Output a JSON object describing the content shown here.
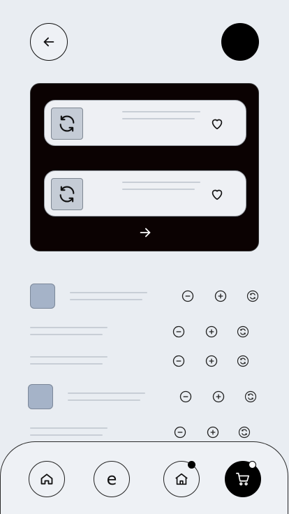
{
  "header": {
    "back_icon": "arrow-left-icon",
    "avatar_color": "#000000"
  },
  "featured": {
    "items": [
      {
        "icon": "refresh-icon",
        "favorite_icon": "heart-icon"
      },
      {
        "icon": "refresh-icon",
        "favorite_icon": "heart-icon"
      }
    ],
    "next_icon": "arrow-right-icon"
  },
  "list": {
    "rows": [
      {
        "has_thumb": true
      },
      {
        "has_thumb": false
      },
      {
        "has_thumb": false
      },
      {
        "has_thumb": true
      },
      {
        "has_thumb": false
      }
    ],
    "controls": [
      "minus-circle-icon",
      "plus-circle-icon",
      "refresh-icon"
    ]
  },
  "bottom_nav": {
    "items": [
      {
        "icon": "home-icon"
      },
      {
        "label": "e"
      },
      {
        "icon": "home-icon",
        "badge": true
      },
      {
        "icon": "cart-icon",
        "active": true,
        "badge": true
      }
    ]
  },
  "colors": {
    "background": "#e9edf2",
    "card": "#0b0202",
    "thumb": "#a5b3c8",
    "accent": "#000000"
  }
}
